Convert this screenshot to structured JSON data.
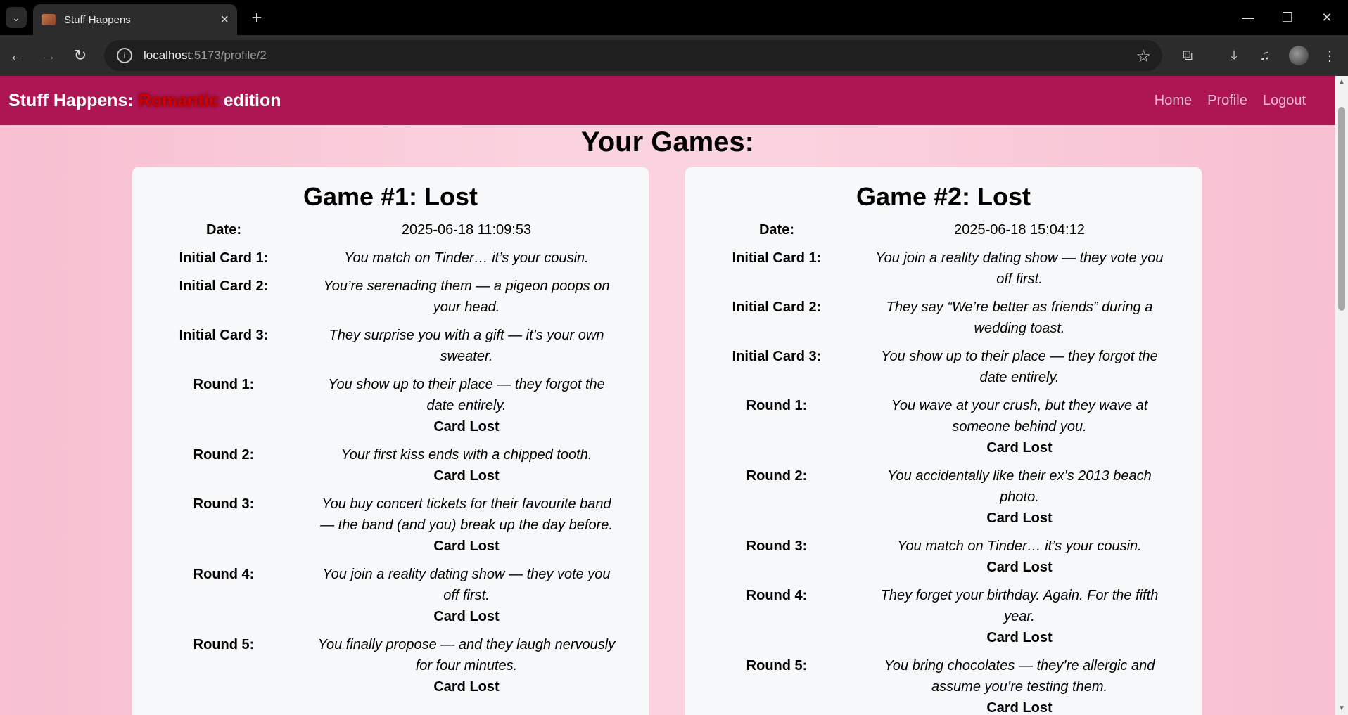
{
  "browser": {
    "tab_title": "Stuff Happens",
    "url_host": "localhost",
    "url_path": ":5173/profile/2"
  },
  "nav": {
    "brand_prefix": "Stuff Happens: ",
    "brand_accent": "Romantic",
    "brand_suffix": " edition",
    "links": [
      "Home",
      "Profile",
      "Logout"
    ]
  },
  "page": {
    "heading": "Your Games:"
  },
  "games": [
    {
      "title": "Game #1: Lost",
      "date_label": "Date:",
      "date": "2025-06-18 11:09:53",
      "initial_cards": [
        {
          "label": "Initial Card 1:",
          "text": "You match on Tinder… it’s your cousin."
        },
        {
          "label": "Initial Card 2:",
          "text": "You’re serenading them — a pigeon poops on your head."
        },
        {
          "label": "Initial Card 3:",
          "text": "They surprise you with a gift — it’s your own sweater."
        }
      ],
      "rounds": [
        {
          "label": "Round 1:",
          "text": "You show up to their place — they forgot the date entirely.",
          "result": "Card Lost"
        },
        {
          "label": "Round 2:",
          "text": "Your first kiss ends with a chipped tooth.",
          "result": "Card Lost"
        },
        {
          "label": "Round 3:",
          "text": "You buy concert tickets for their favourite band — the band (and you) break up the day before.",
          "result": "Card Lost"
        },
        {
          "label": "Round 4:",
          "text": "You join a reality dating show — they vote you off first.",
          "result": "Card Lost"
        },
        {
          "label": "Round 5:",
          "text": "You finally propose — and they laugh nervously for four minutes.",
          "result": "Card Lost"
        }
      ]
    },
    {
      "title": "Game #2: Lost",
      "date_label": "Date:",
      "date": "2025-06-18 15:04:12",
      "initial_cards": [
        {
          "label": "Initial Card 1:",
          "text": "You join a reality dating show — they vote you off first."
        },
        {
          "label": "Initial Card 2:",
          "text": "They say “We’re better as friends” during a wedding toast."
        },
        {
          "label": "Initial Card 3:",
          "text": "You show up to their place — they forgot the date entirely."
        }
      ],
      "rounds": [
        {
          "label": "Round 1:",
          "text": "You wave at your crush, but they wave at someone behind you.",
          "result": "Card Lost"
        },
        {
          "label": "Round 2:",
          "text": "You accidentally like their ex’s 2013 beach photo.",
          "result": "Card Lost"
        },
        {
          "label": "Round 3:",
          "text": "You match on Tinder… it’s your cousin.",
          "result": "Card Lost"
        },
        {
          "label": "Round 4:",
          "text": "They forget your birthday. Again. For the fifth year.",
          "result": "Card Lost"
        },
        {
          "label": "Round 5:",
          "text": "You bring chocolates — they’re allergic and assume you’re testing them.",
          "result": "Card Lost"
        }
      ]
    }
  ]
}
